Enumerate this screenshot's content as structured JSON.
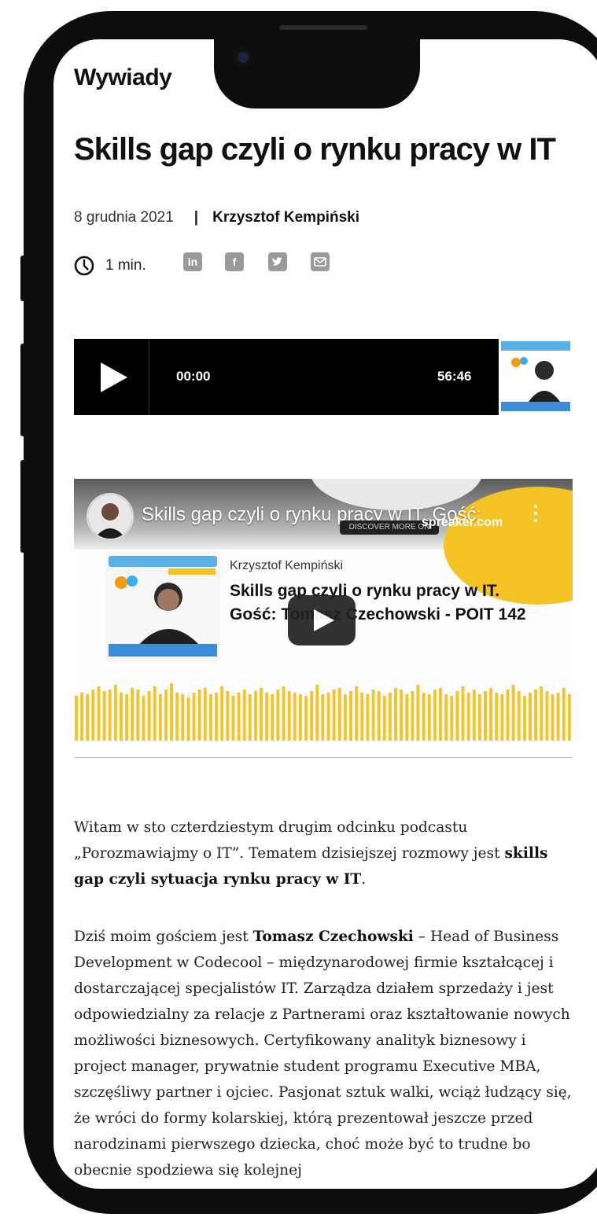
{
  "article": {
    "section": "Wywiady",
    "title": "Skills gap czyli o rynku pracy w IT",
    "date": "8 grudnia 2021",
    "separator": "|",
    "author": "Krzysztof Kempiński",
    "read_time": "1 min.",
    "share_icons": [
      "linkedin-icon",
      "facebook-icon",
      "twitter-icon",
      "email-icon"
    ]
  },
  "player": {
    "current_time": "00:00",
    "duration": "56:46",
    "progress": 0
  },
  "video": {
    "title": "Skills gap czyli o rynku pracy w IT. Gość:",
    "brand": "spreaker.com",
    "discover": "DISCOVER MORE ON",
    "episode_author": "Krzysztof Kempiński",
    "episode_title": "Skills gap czyli o rynku pracy w IT. Gość: Tomasz Czechowski - POIT 142",
    "accent_color": "#f6c324",
    "waveform": [
      58,
      62,
      60,
      66,
      70,
      64,
      66,
      72,
      62,
      60,
      68,
      66,
      58,
      64,
      70,
      60,
      66,
      74,
      62,
      60,
      56,
      62,
      66,
      68,
      60,
      62,
      70,
      64,
      58,
      62,
      66,
      60,
      64,
      68,
      62,
      60,
      66,
      70,
      64,
      62,
      60,
      58,
      64,
      72,
      60,
      62,
      66,
      68,
      60,
      64,
      70,
      62,
      60,
      66,
      64,
      58,
      62,
      68,
      66,
      60,
      64,
      72,
      62,
      60,
      66,
      68,
      60,
      58,
      64,
      70,
      62,
      66,
      60,
      64,
      68,
      62,
      60,
      66,
      72,
      64,
      58,
      62,
      66,
      70,
      64,
      60,
      62,
      68,
      60
    ]
  },
  "body": {
    "p1_a": "Witam w sto czterdziestym drugim odcinku podcastu „Porozmawiajmy o IT”. Tematem dzisiejszej rozmowy jest ",
    "p1_b": "skills gap czyli sytuacja rynku pracy w IT",
    "p1_c": ".",
    "p2_a": "Dziś moim gościem jest ",
    "p2_b": "Tomasz Czechowski",
    "p2_c": " – Head of Business Development w Codecool – międzynarodowej firmie kształcącej i dostarczającej specjalistów IT. Zarządza działem sprzedaży i jest odpowiedzialny za relacje z Partnerami oraz kształtowanie nowych możliwości biznesowych. Certyfikowany analityk biznesowy i project manager, prywatnie student programu Executive MBA, szczęśliwy partner i ojciec. Pasjonat sztuk walki, wciąż łudzący się, że wróci do formy kolarskiej, którą prezentował jeszcze przed narodzinami pierwszego dziecka, choć może być to trudne bo obecnie spodziewa się kolejnej"
  }
}
